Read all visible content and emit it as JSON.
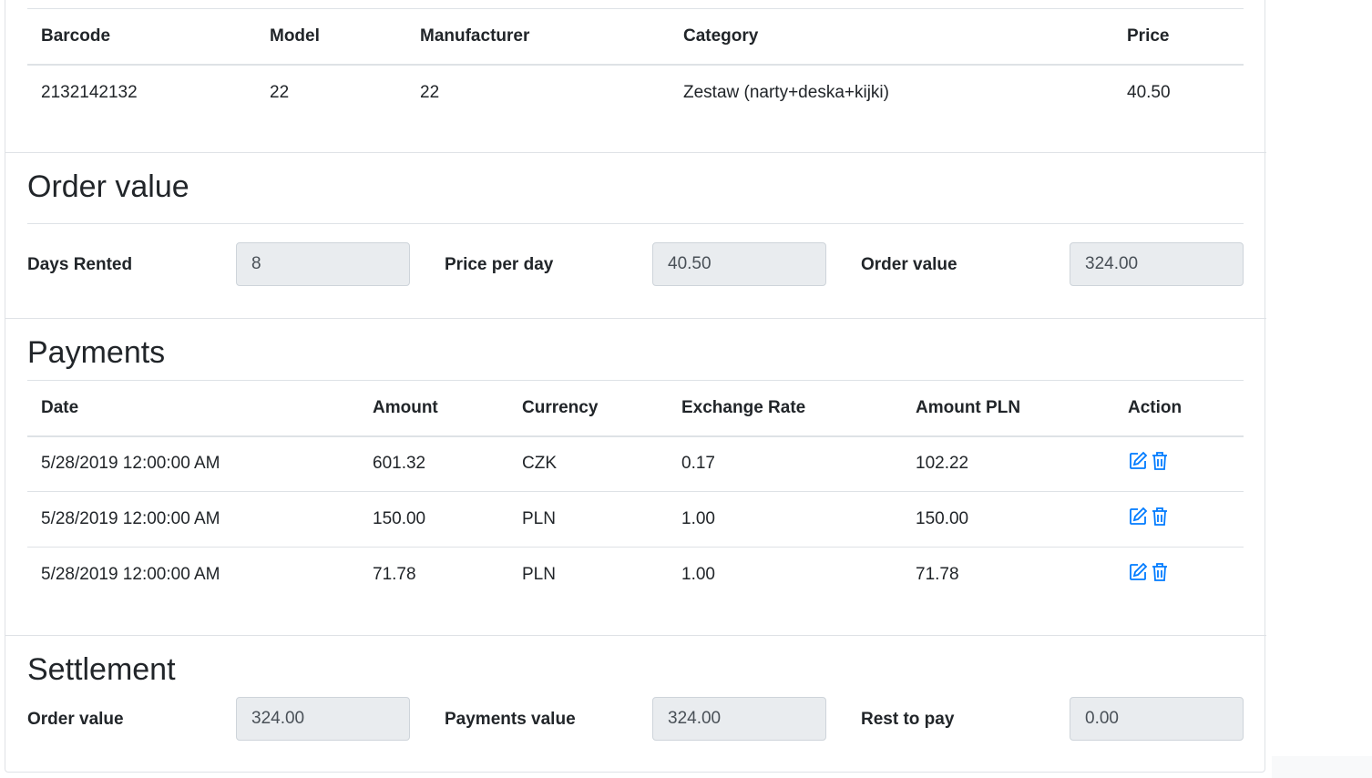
{
  "items_table": {
    "headers": [
      "Barcode",
      "Model",
      "Manufacturer",
      "Category",
      "Price"
    ],
    "rows": [
      [
        "2132142132",
        "22",
        "22",
        "Zestaw (narty+deska+kijki)",
        "40.50"
      ]
    ]
  },
  "order_value_section": {
    "title": "Order value",
    "days_rented_label": "Days Rented",
    "days_rented_value": "8",
    "price_per_day_label": "Price per day",
    "price_per_day_value": "40.50",
    "order_value_label": "Order value",
    "order_value_value": "324.00"
  },
  "payments_section": {
    "title": "Payments",
    "headers": [
      "Date",
      "Amount",
      "Currency",
      "Exchange Rate",
      "Amount PLN",
      "Action"
    ],
    "rows": [
      [
        "5/28/2019 12:00:00 AM",
        "601.32",
        "CZK",
        "0.17",
        "102.22"
      ],
      [
        "5/28/2019 12:00:00 AM",
        "150.00",
        "PLN",
        "1.00",
        "150.00"
      ],
      [
        "5/28/2019 12:00:00 AM",
        "71.78",
        "PLN",
        "1.00",
        "71.78"
      ]
    ],
    "action_icons": [
      "edit-icon",
      "trash-icon"
    ],
    "action_color": "#007bff"
  },
  "settlement_section": {
    "title": "Settlement",
    "order_value_label": "Order value",
    "order_value_value": "324.00",
    "payments_value_label": "Payments value",
    "payments_value_value": "324.00",
    "rest_to_pay_label": "Rest to pay",
    "rest_to_pay_value": "0.00"
  }
}
